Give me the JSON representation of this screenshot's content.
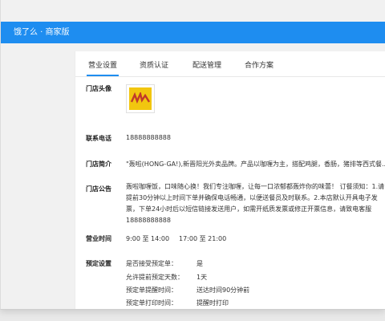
{
  "app": {
    "title": "饿了么 · 商家版"
  },
  "tabs": [
    {
      "label": "营业设置",
      "active": true
    },
    {
      "label": "资质认证"
    },
    {
      "label": "配送管理"
    },
    {
      "label": "合作方案"
    }
  ],
  "store": {
    "avatar_label": "门店头像",
    "phone_label": "联系电话",
    "phone": "18888888888",
    "intro_label": "门店简介",
    "intro": "\"轰啦(HONG-GA!),新晋阳光外卖品牌。产品以咖喱为主，搭配鸡腿，香肠，猪排等西式餐...",
    "notice_label": "门店公告",
    "notice": "轰啦咖喱饭，口味随心换！我们专注咖喱，让每一口浓郁都轰炸你的味蕾！ 订餐须知：1.请提前30分钟以上时间下单并确保电话畅通，以便送餐员及时联系。2.本店默认开具电子发票，下单24小时后以短信链接发送用户，如需开纸质发票或修正开票信息，请致电客服18888888888",
    "hours_label": "营业时间",
    "hours": [
      "9:00 至 14:00",
      "17:00 至 21:00"
    ]
  },
  "reservation": {
    "label": "预定设置",
    "items": [
      {
        "k": "是否接受预定单：",
        "v": "是"
      },
      {
        "k": "允许提前预定天数：",
        "v": "1天"
      },
      {
        "k": "预定单提醒时间：",
        "v": "送达时间90分钟前"
      },
      {
        "k": "预定单打印时间：",
        "v": "提醒时打印"
      }
    ]
  },
  "colors": {
    "brand": "#1e8df0",
    "logo_bg": "#f2c60f"
  }
}
